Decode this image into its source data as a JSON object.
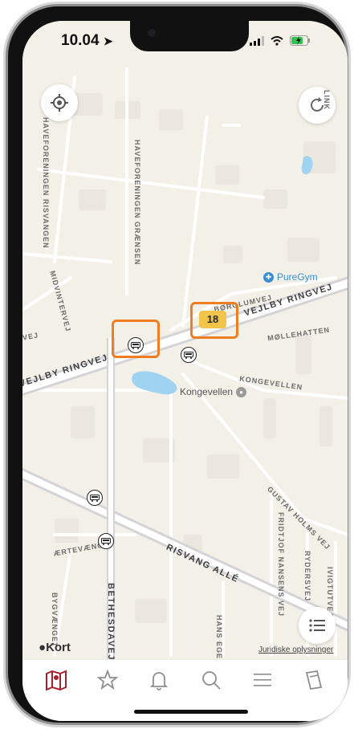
{
  "status_bar": {
    "time": "10.04"
  },
  "map": {
    "streets": [
      "HAVEFORENINGEN RISVANGEN",
      "HAVEFORENINGEN GRÆNSEN",
      "MIDVINTERVEJ",
      "BØRGLUMVEJ",
      "MØLLEHATTEN",
      "KONGEVELLEN",
      "GUSTAV HOLMS VEJ",
      "FRIDTJOF NANSENS VEJ",
      "RYDERSVEJ",
      "IVIGTUTVEJ",
      "ÆRTEVÆNGET",
      "BYGVÆNGET",
      "HANS EGEDES",
      "VEJ",
      "LINK"
    ],
    "major_roads": [
      "VEJLBY RINGVEJ",
      "VEJLBY RINGVEJ",
      "RISVANG ALLÉ",
      "BETHESDAVEJ"
    ],
    "pois": {
      "gym": "PureGym",
      "stop": "Kongevellen"
    },
    "route_badge": "18",
    "highlight_color": "#ef7d22",
    "route_color": "#f2c54a",
    "attribution": "Kort",
    "legal_link": "Juridiske oplysninger"
  },
  "tabs": [
    "map-icon",
    "star-icon",
    "bell-icon",
    "search-icon",
    "menu-icon",
    "tickets-icon"
  ],
  "accent_color": "#a3222d"
}
